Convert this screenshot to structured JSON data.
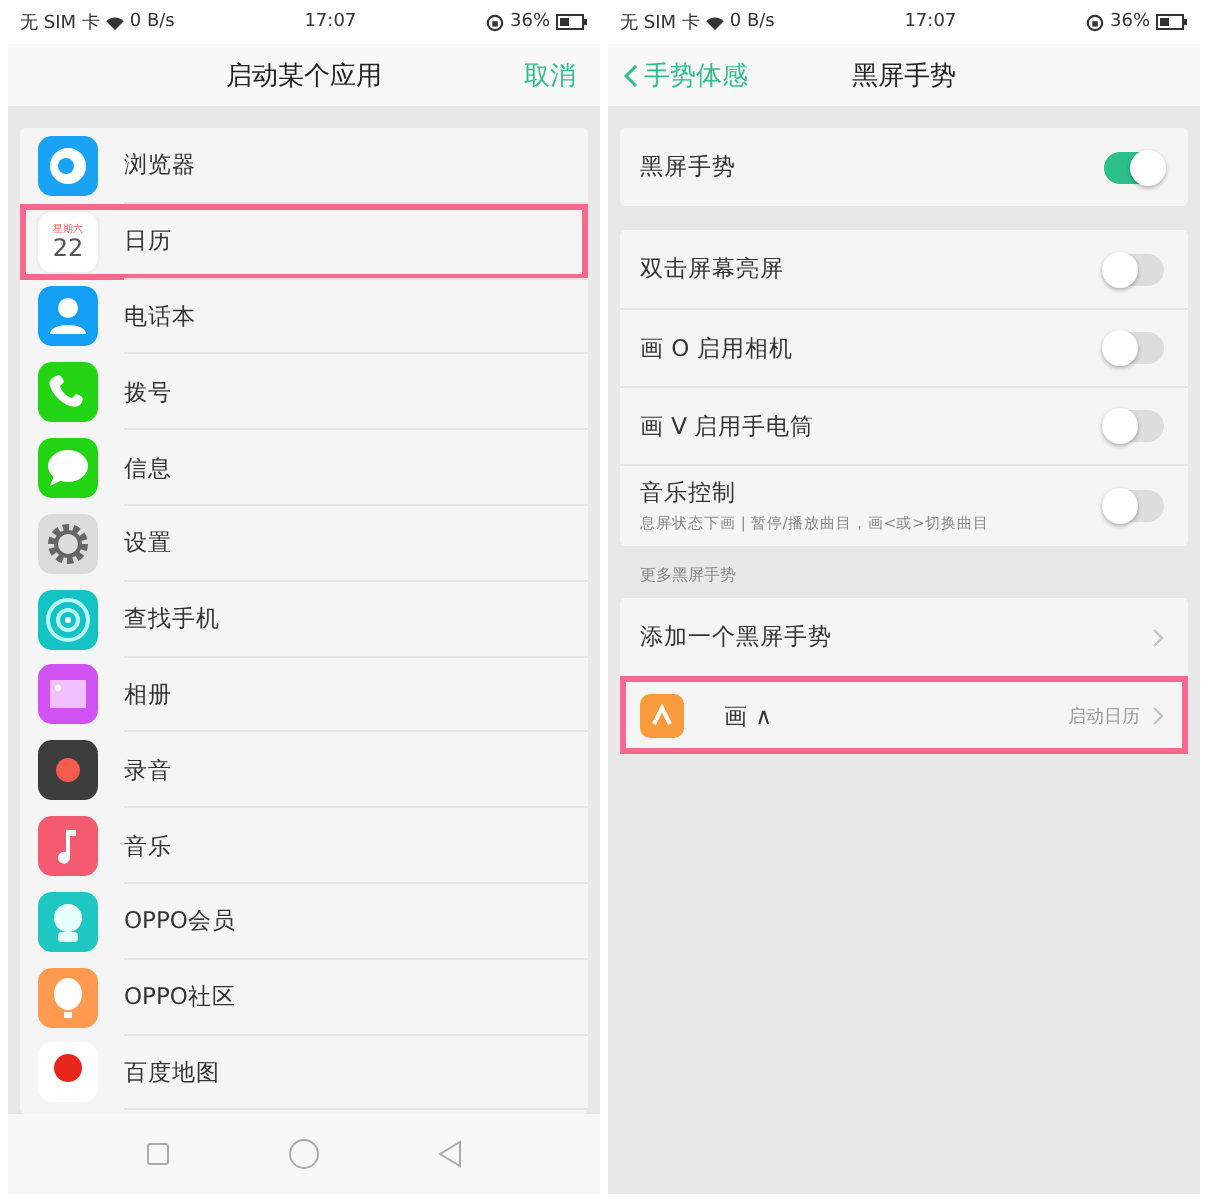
{
  "left": {
    "status_bar": {
      "carrier": "无 SIM 卡",
      "speed": "0 B/s",
      "time": "17:07",
      "battery": "36%"
    },
    "header": {
      "title": "启动某个应用",
      "action": "取消"
    },
    "apps": [
      {
        "label": "浏览器",
        "highlighted": false
      },
      {
        "label": "日历",
        "highlighted": true,
        "icon_weekday": "星期六",
        "icon_day": "22"
      },
      {
        "label": "电话本",
        "highlighted": false
      },
      {
        "label": "拨号",
        "highlighted": false
      },
      {
        "label": "信息",
        "highlighted": false
      },
      {
        "label": "设置",
        "highlighted": false
      },
      {
        "label": "查找手机",
        "highlighted": false
      },
      {
        "label": "相册",
        "highlighted": false
      },
      {
        "label": "录音",
        "highlighted": false
      },
      {
        "label": "音乐",
        "highlighted": false
      },
      {
        "label": "OPPO会员",
        "highlighted": false
      },
      {
        "label": "OPPO社区",
        "highlighted": false
      },
      {
        "label": "百度地图",
        "highlighted": false
      }
    ]
  },
  "right": {
    "status_bar": {
      "carrier": "无 SIM 卡",
      "speed": "0 B/s",
      "time": "17:07",
      "battery": "36%"
    },
    "header": {
      "back": "手势体感",
      "title": "黑屏手势"
    },
    "master": {
      "label": "黑屏手势",
      "on": true
    },
    "gestures": [
      {
        "label": "双击屏幕亮屏",
        "on": false
      },
      {
        "label": "画 O 启用相机",
        "on": false
      },
      {
        "label": "画 V 启用手电筒",
        "on": false
      },
      {
        "label": "音乐控制",
        "subtitle": "息屏状态下画 | 暂停/播放曲目，画<或>切换曲目",
        "on": false
      }
    ],
    "section": "更多黑屏手势",
    "more": [
      {
        "kind": "add",
        "label": "添加一个黑屏手势",
        "highlighted": false
      },
      {
        "kind": "custom",
        "label": "画 ∧",
        "value": "启动日历",
        "highlighted": true
      }
    ]
  }
}
